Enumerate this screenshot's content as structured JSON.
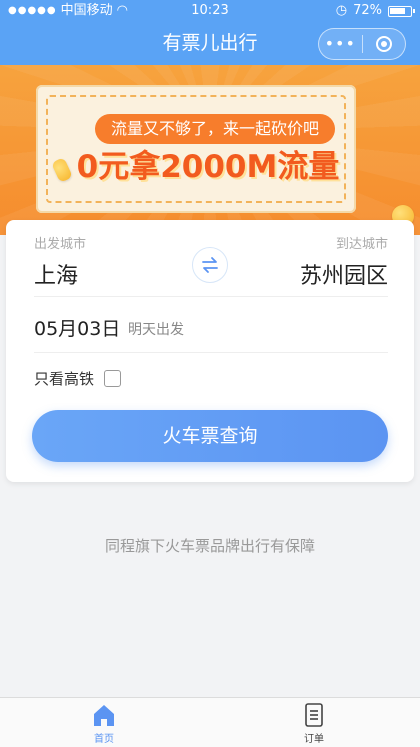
{
  "status_bar": {
    "carrier": "中国移动",
    "time": "10:23",
    "battery": "72%"
  },
  "nav": {
    "title": "有票儿出行",
    "more_icon": "more-dots-icon",
    "close_icon": "close-target-icon"
  },
  "banner": {
    "slogan": "流量又不够了，来一起砍价吧",
    "headline": "0元拿2000M流量"
  },
  "search": {
    "departure_label": "出发城市",
    "departure_city": "上海",
    "arrival_label": "到达城市",
    "arrival_city": "苏州园区",
    "date": "05月03日",
    "day_note": "明天出发",
    "high_speed_label": "只看高铁",
    "high_speed_checked": false,
    "button_label": "火车票查询"
  },
  "footer_slogan": "同程旗下火车票品牌出行有保障",
  "tabbar": {
    "items": [
      {
        "label": "首页",
        "icon": "home-icon",
        "active": true
      },
      {
        "label": "订单",
        "icon": "order-list-icon",
        "active": false
      }
    ]
  },
  "colors": {
    "primary": "#5aa3f5",
    "button": "#5b94f2",
    "banner_orange": "#f58c2d"
  }
}
